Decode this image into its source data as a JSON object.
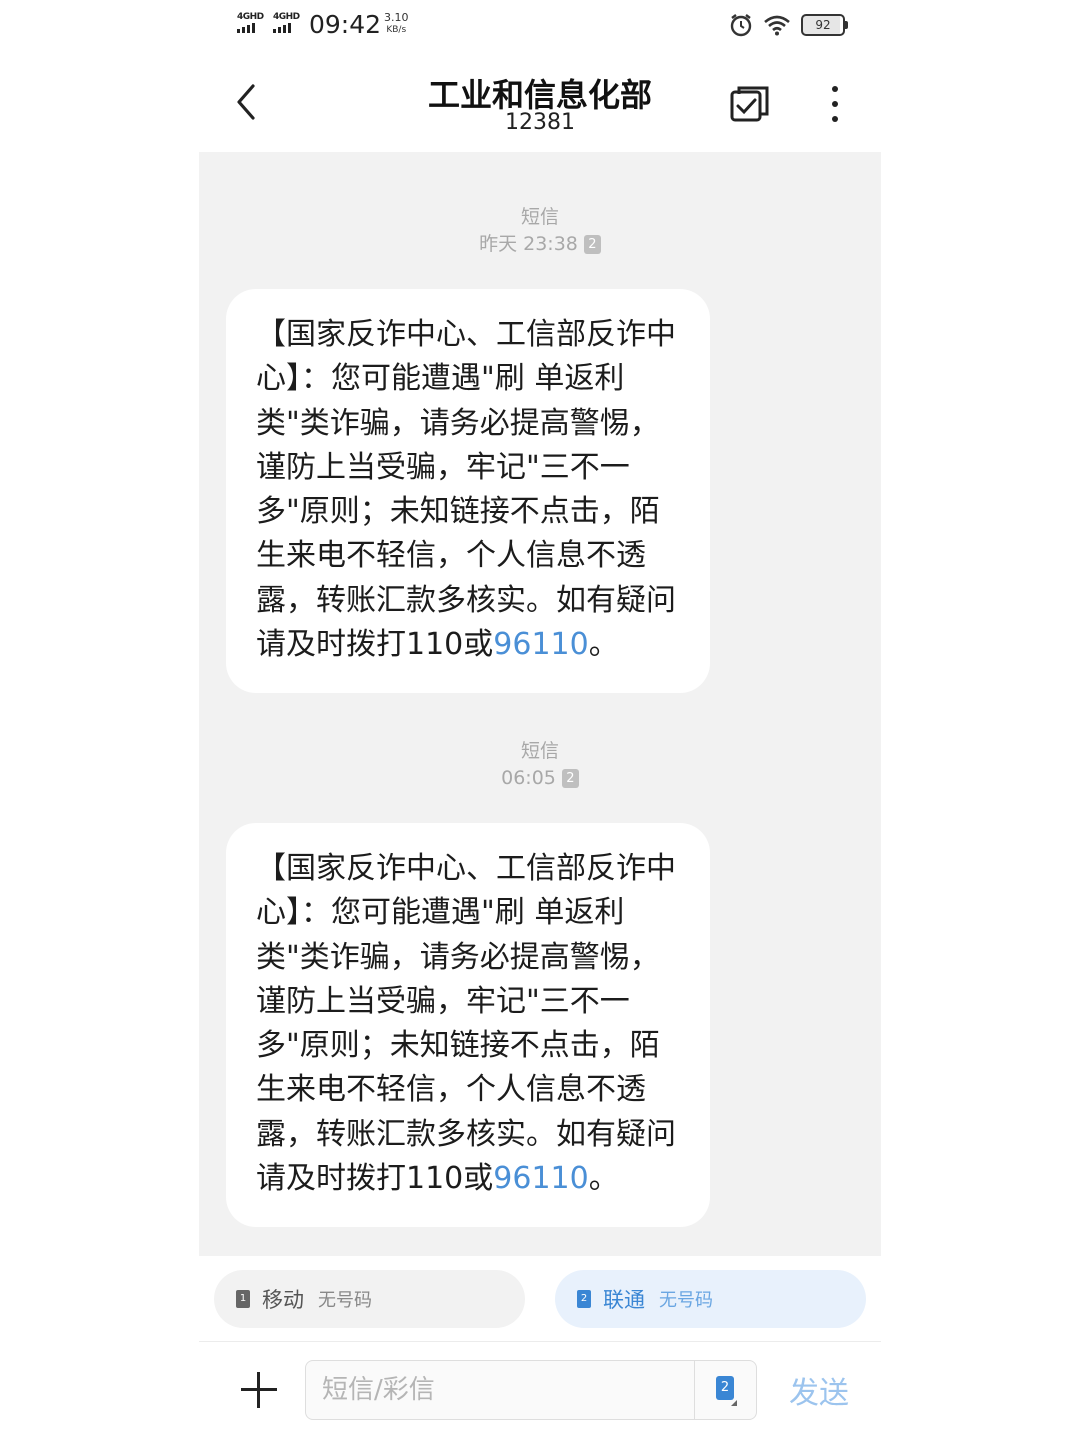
{
  "status_bar": {
    "signal1": "4GHD",
    "signal2": "4GHD",
    "time": "09:42",
    "speed_value": "3.10",
    "speed_unit": "KB/s",
    "battery": "92"
  },
  "header": {
    "title": "工业和信息化部",
    "number": "12381",
    "icons": [
      "back-arrow-icon",
      "select-checkbox-icon",
      "more-vertical-icon"
    ]
  },
  "messages": [
    {
      "type_label": "短信",
      "time": "昨天 23:38",
      "sim_badge": "2",
      "text_before": "【国家反诈中心、工信部反诈中心】：您可能遭遇\"刷 单返利类\"类诈骗，请务必提高警惕，谨防上当受骗，牢记\"三不一多\"原则；未知链接不点击，陌生来电不轻信，个人信息不透露，转账汇款多核实。如有疑问请及时拨打110或",
      "link": "96110",
      "text_after": "。"
    },
    {
      "type_label": "短信",
      "time": "06:05",
      "sim_badge": "2",
      "text_before": "【国家反诈中心、工信部反诈中心】：您可能遭遇\"刷 单返利类\"类诈骗，请务必提高警惕，谨防上当受骗，牢记\"三不一多\"原则；未知链接不点击，陌生来电不轻信，个人信息不透露，转账汇款多核实。如有疑问请及时拨打110或",
      "link": "96110",
      "text_after": "。"
    }
  ],
  "sim_selector": {
    "sim1": {
      "badge": "1",
      "name": "移动",
      "number": "无号码"
    },
    "sim2": {
      "badge": "2",
      "name": "联通",
      "number": "无号码"
    }
  },
  "composer": {
    "placeholder": "短信/彩信",
    "sim_badge": "2",
    "send_label": "发送"
  },
  "colors": {
    "link": "#4a8fd6",
    "sim2_active": "#3a86d4",
    "conversation_bg": "#f2f2f2",
    "send_disabled": "#9cc4ee"
  }
}
